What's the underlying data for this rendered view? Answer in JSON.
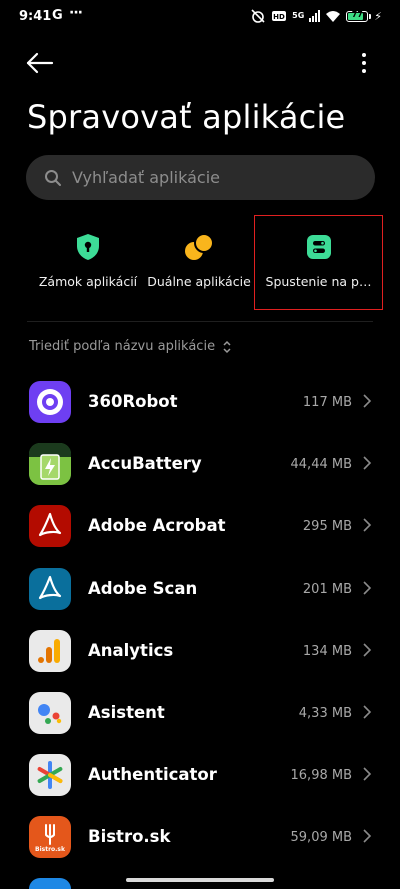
{
  "status_bar": {
    "time": "9:41",
    "google_label": "G",
    "more_notifications": "···",
    "battery_level": "77",
    "network_label": "5G"
  },
  "header": {
    "title": "Spravovať aplikácie"
  },
  "search": {
    "placeholder": "Vyhľadať aplikácie"
  },
  "features": [
    {
      "label": "Zámok aplikácií",
      "icon": "shield-lock-icon",
      "color": "#3ddc97"
    },
    {
      "label": "Duálne aplikácie",
      "icon": "dual-circles-icon",
      "color": "#f9b51c"
    },
    {
      "label": "Spustenie na p…",
      "icon": "autostart-icon",
      "color": "#3ddc97"
    }
  ],
  "sort": {
    "label": "Triediť podľa názvu aplikácie"
  },
  "apps": [
    {
      "name": "360Robot",
      "size": "117 MB",
      "icon": "360robot-icon"
    },
    {
      "name": "AccuBattery",
      "size": "44,44 MB",
      "icon": "accubattery-icon"
    },
    {
      "name": "Adobe Acrobat",
      "size": "295 MB",
      "icon": "adobe-acrobat-icon"
    },
    {
      "name": "Adobe Scan",
      "size": "201 MB",
      "icon": "adobe-scan-icon"
    },
    {
      "name": "Analytics",
      "size": "134 MB",
      "icon": "analytics-icon"
    },
    {
      "name": "Asistent",
      "size": "4,33 MB",
      "icon": "assistant-icon"
    },
    {
      "name": "Authenticator",
      "size": "16,98 MB",
      "icon": "authenticator-icon"
    },
    {
      "name": "Bistro.sk",
      "size": "59,09 MB",
      "icon": "bistro-icon",
      "icon_text": "Bistro.sk"
    }
  ]
}
